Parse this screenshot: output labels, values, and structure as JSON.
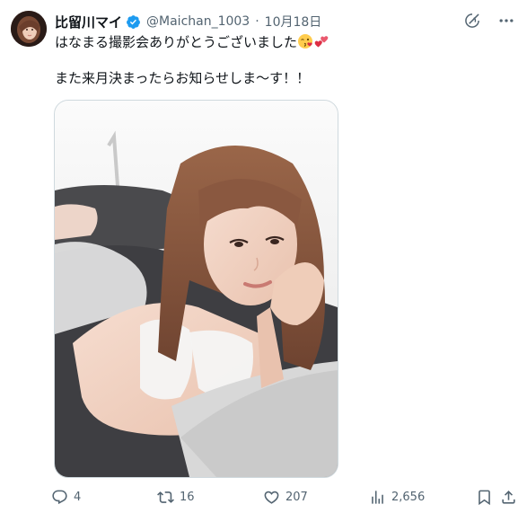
{
  "author": {
    "display_name": "比留川マイ",
    "handle": "@Maichan_1003",
    "separator": "·",
    "date": "10月18日",
    "verified": true
  },
  "header_icons": [
    "grok-icon",
    "more-icon"
  ],
  "tweet": {
    "line1": "はなまる撮影会ありがとうございました",
    "line1_emojis": [
      "face-blowing-kiss-emoji",
      "two-hearts-emoji"
    ],
    "line2": "また来月決まったらお知らせしま〜す！！"
  },
  "media": {
    "type": "photo",
    "icon": "photo"
  },
  "actions": {
    "reply_count": "4",
    "retweet_count": "16",
    "like_count": "207",
    "views_count": "2,656"
  },
  "colors": {
    "text": "#0f1419",
    "secondary": "#536471",
    "verified": "#1d9bf0",
    "border": "#cfd9de"
  }
}
